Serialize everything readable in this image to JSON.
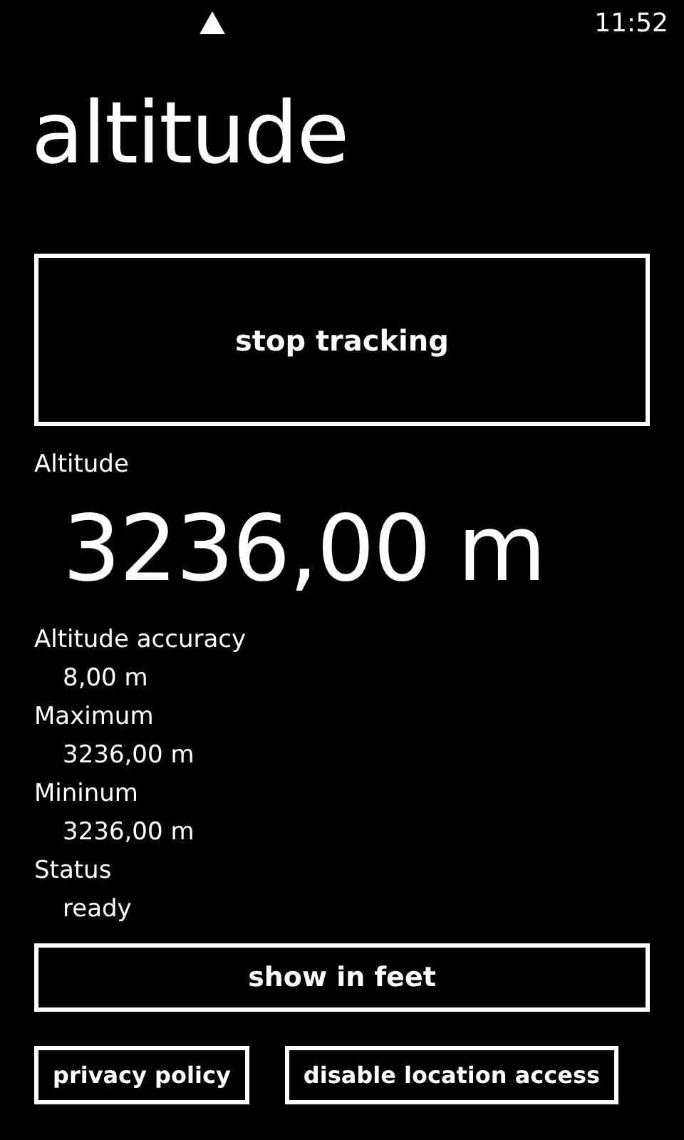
{
  "status_bar": {
    "time": "11:52"
  },
  "page_title": "altitude",
  "tracking_button": {
    "label": "stop tracking"
  },
  "altitude": {
    "label": "Altitude",
    "value": "3236,00 m"
  },
  "details": [
    {
      "label": "Altitude accuracy",
      "value": "8,00 m"
    },
    {
      "label": "Maximum",
      "value": "3236,00 m"
    },
    {
      "label": "Mininum",
      "value": "3236,00 m"
    },
    {
      "label": "Status",
      "value": "ready"
    }
  ],
  "units_button": {
    "label": "show in feet"
  },
  "footer_buttons": [
    "privacy policy",
    "disable location access"
  ]
}
